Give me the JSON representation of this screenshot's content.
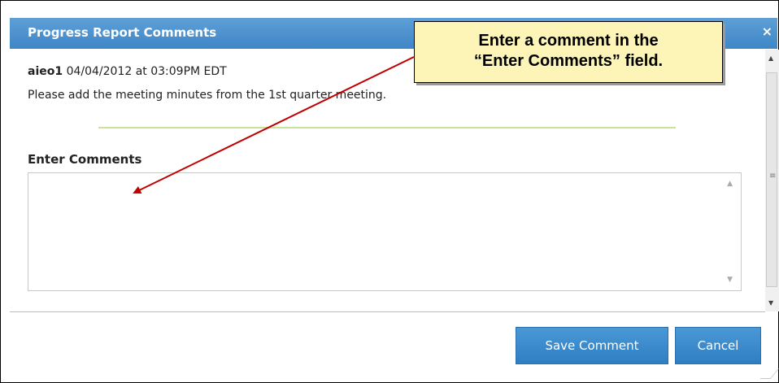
{
  "dialog": {
    "title": "Progress Report Comments",
    "close_symbol": "×"
  },
  "comment": {
    "author": "aieo1",
    "timestamp": "04/04/2012 at 03:09PM EDT",
    "text": "Please add the meeting minutes from the 1st quarter meeting."
  },
  "form": {
    "label": "Enter Comments",
    "value": ""
  },
  "buttons": {
    "save": "Save Comment",
    "cancel": "Cancel"
  },
  "annotation": {
    "text": "Enter a comment in the\n“Enter Comments” field.",
    "arrow_color": "#c00000",
    "background": "#fdf5b8"
  }
}
